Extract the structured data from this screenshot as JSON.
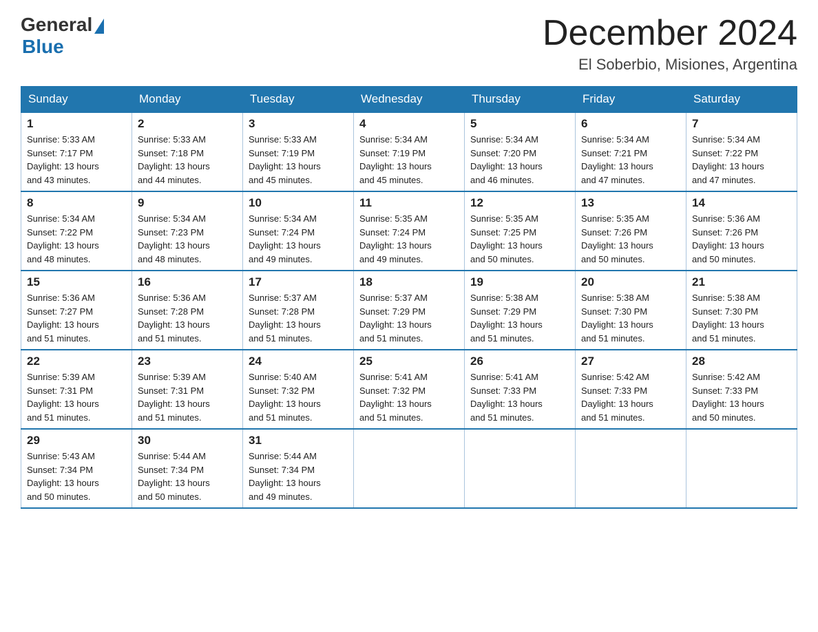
{
  "logo": {
    "general": "General",
    "blue": "Blue"
  },
  "title": "December 2024",
  "location": "El Soberbio, Misiones, Argentina",
  "days_of_week": [
    "Sunday",
    "Monday",
    "Tuesday",
    "Wednesday",
    "Thursday",
    "Friday",
    "Saturday"
  ],
  "weeks": [
    [
      {
        "day": "1",
        "sunrise": "5:33 AM",
        "sunset": "7:17 PM",
        "daylight": "13 hours and 43 minutes."
      },
      {
        "day": "2",
        "sunrise": "5:33 AM",
        "sunset": "7:18 PM",
        "daylight": "13 hours and 44 minutes."
      },
      {
        "day": "3",
        "sunrise": "5:33 AM",
        "sunset": "7:19 PM",
        "daylight": "13 hours and 45 minutes."
      },
      {
        "day": "4",
        "sunrise": "5:34 AM",
        "sunset": "7:19 PM",
        "daylight": "13 hours and 45 minutes."
      },
      {
        "day": "5",
        "sunrise": "5:34 AM",
        "sunset": "7:20 PM",
        "daylight": "13 hours and 46 minutes."
      },
      {
        "day": "6",
        "sunrise": "5:34 AM",
        "sunset": "7:21 PM",
        "daylight": "13 hours and 47 minutes."
      },
      {
        "day": "7",
        "sunrise": "5:34 AM",
        "sunset": "7:22 PM",
        "daylight": "13 hours and 47 minutes."
      }
    ],
    [
      {
        "day": "8",
        "sunrise": "5:34 AM",
        "sunset": "7:22 PM",
        "daylight": "13 hours and 48 minutes."
      },
      {
        "day": "9",
        "sunrise": "5:34 AM",
        "sunset": "7:23 PM",
        "daylight": "13 hours and 48 minutes."
      },
      {
        "day": "10",
        "sunrise": "5:34 AM",
        "sunset": "7:24 PM",
        "daylight": "13 hours and 49 minutes."
      },
      {
        "day": "11",
        "sunrise": "5:35 AM",
        "sunset": "7:24 PM",
        "daylight": "13 hours and 49 minutes."
      },
      {
        "day": "12",
        "sunrise": "5:35 AM",
        "sunset": "7:25 PM",
        "daylight": "13 hours and 50 minutes."
      },
      {
        "day": "13",
        "sunrise": "5:35 AM",
        "sunset": "7:26 PM",
        "daylight": "13 hours and 50 minutes."
      },
      {
        "day": "14",
        "sunrise": "5:36 AM",
        "sunset": "7:26 PM",
        "daylight": "13 hours and 50 minutes."
      }
    ],
    [
      {
        "day": "15",
        "sunrise": "5:36 AM",
        "sunset": "7:27 PM",
        "daylight": "13 hours and 51 minutes."
      },
      {
        "day": "16",
        "sunrise": "5:36 AM",
        "sunset": "7:28 PM",
        "daylight": "13 hours and 51 minutes."
      },
      {
        "day": "17",
        "sunrise": "5:37 AM",
        "sunset": "7:28 PM",
        "daylight": "13 hours and 51 minutes."
      },
      {
        "day": "18",
        "sunrise": "5:37 AM",
        "sunset": "7:29 PM",
        "daylight": "13 hours and 51 minutes."
      },
      {
        "day": "19",
        "sunrise": "5:38 AM",
        "sunset": "7:29 PM",
        "daylight": "13 hours and 51 minutes."
      },
      {
        "day": "20",
        "sunrise": "5:38 AM",
        "sunset": "7:30 PM",
        "daylight": "13 hours and 51 minutes."
      },
      {
        "day": "21",
        "sunrise": "5:38 AM",
        "sunset": "7:30 PM",
        "daylight": "13 hours and 51 minutes."
      }
    ],
    [
      {
        "day": "22",
        "sunrise": "5:39 AM",
        "sunset": "7:31 PM",
        "daylight": "13 hours and 51 minutes."
      },
      {
        "day": "23",
        "sunrise": "5:39 AM",
        "sunset": "7:31 PM",
        "daylight": "13 hours and 51 minutes."
      },
      {
        "day": "24",
        "sunrise": "5:40 AM",
        "sunset": "7:32 PM",
        "daylight": "13 hours and 51 minutes."
      },
      {
        "day": "25",
        "sunrise": "5:41 AM",
        "sunset": "7:32 PM",
        "daylight": "13 hours and 51 minutes."
      },
      {
        "day": "26",
        "sunrise": "5:41 AM",
        "sunset": "7:33 PM",
        "daylight": "13 hours and 51 minutes."
      },
      {
        "day": "27",
        "sunrise": "5:42 AM",
        "sunset": "7:33 PM",
        "daylight": "13 hours and 51 minutes."
      },
      {
        "day": "28",
        "sunrise": "5:42 AM",
        "sunset": "7:33 PM",
        "daylight": "13 hours and 50 minutes."
      }
    ],
    [
      {
        "day": "29",
        "sunrise": "5:43 AM",
        "sunset": "7:34 PM",
        "daylight": "13 hours and 50 minutes."
      },
      {
        "day": "30",
        "sunrise": "5:44 AM",
        "sunset": "7:34 PM",
        "daylight": "13 hours and 50 minutes."
      },
      {
        "day": "31",
        "sunrise": "5:44 AM",
        "sunset": "7:34 PM",
        "daylight": "13 hours and 49 minutes."
      },
      null,
      null,
      null,
      null
    ]
  ],
  "labels": {
    "sunrise": "Sunrise:",
    "sunset": "Sunset:",
    "daylight": "Daylight:"
  }
}
